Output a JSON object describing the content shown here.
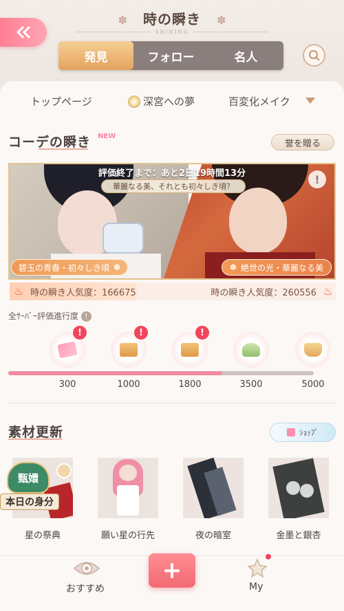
{
  "header": {
    "title": "時の瞬き",
    "subtitle": "SHINING",
    "back_icon": "double-chevron-left-icon",
    "search_icon": "search-icon"
  },
  "tabs": [
    {
      "label": "発見",
      "active": true
    },
    {
      "label": "フォロー",
      "active": false
    },
    {
      "label": "名人",
      "active": false
    }
  ],
  "subnav": {
    "items": [
      "トップページ",
      "深宮への夢",
      "百変化メイク"
    ]
  },
  "coordinate_section": {
    "title": "コーデの瞬き",
    "badge": "NEW",
    "gift_button": "誉を贈る",
    "countdown": "評価終了まで：あと2日19時間13分",
    "question": "華麗なる美、それとも初々しき頃？",
    "info_label": "!",
    "left_choice": "碧玉の青春・初々しき頃",
    "right_choice": "絶世の光・華麗なる美",
    "left_popularity": "時の瞬き人気度：166675",
    "right_popularity": "時の瞬き人気度：260556",
    "left_share": 0.39
  },
  "progress": {
    "label": "全ｻｰﾊﾞｰ評価進行度",
    "help": "!",
    "fraction": 0.7,
    "milestones": [
      "300",
      "1000",
      "1800",
      "3500",
      "5000"
    ],
    "alert_mark": "!"
  },
  "materials": {
    "title": "素材更新",
    "shop_button": "ｼｮｯﾌﾟ",
    "seal_text": "甄嬛",
    "ribbon_text": "本日の身分",
    "items": [
      "星の祭典",
      "願い星の行先",
      "夜の暗室",
      "金墨と銀杏"
    ]
  },
  "bottom_nav": {
    "recommend_label": "おすすめ",
    "plus_label": "+",
    "my_label": "My"
  }
}
